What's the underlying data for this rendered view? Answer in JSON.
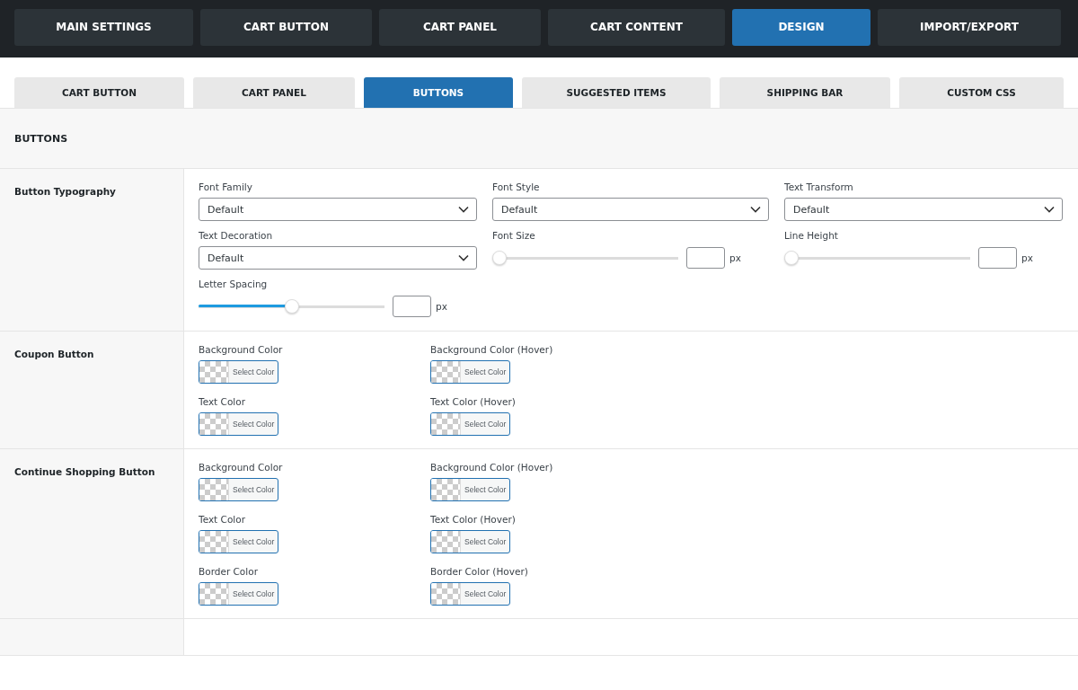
{
  "main_tabs": [
    {
      "label": "MAIN SETTINGS",
      "selected": false
    },
    {
      "label": "CART BUTTON",
      "selected": false
    },
    {
      "label": "CART PANEL",
      "selected": false
    },
    {
      "label": "CART CONTENT",
      "selected": false
    },
    {
      "label": "DESIGN",
      "selected": true
    },
    {
      "label": "IMPORT/EXPORT",
      "selected": false
    }
  ],
  "sub_tabs": [
    {
      "label": "CART BUTTON",
      "selected": false
    },
    {
      "label": "CART PANEL",
      "selected": false
    },
    {
      "label": "BUTTONS",
      "selected": true
    },
    {
      "label": "SUGGESTED ITEMS",
      "selected": false
    },
    {
      "label": "SHIPPING BAR",
      "selected": false
    },
    {
      "label": "CUSTOM CSS",
      "selected": false
    }
  ],
  "section_title": "BUTTONS",
  "rows": [
    {
      "label": "Button Typography",
      "kind": "typography",
      "fields": [
        {
          "kind": "select",
          "label": "Font Family",
          "value": "Default"
        },
        {
          "kind": "select",
          "label": "Font Style",
          "value": "Default"
        },
        {
          "kind": "select",
          "label": "Text Transform",
          "value": "Default"
        },
        {
          "kind": "select",
          "label": "Text Decoration",
          "value": "Default"
        },
        {
          "kind": "slider",
          "label": "Font Size",
          "level": 0,
          "unit": "px"
        },
        {
          "kind": "slider",
          "label": "Line Height",
          "level": 0,
          "unit": "px"
        },
        {
          "kind": "slider",
          "label": "Letter Spacing",
          "level": 0.5,
          "unit": "px"
        }
      ]
    },
    {
      "label": "Coupon Button",
      "kind": "colors",
      "fields": [
        {
          "label": "Background Color",
          "button": "Select Color"
        },
        {
          "label": "Background Color (Hover)",
          "button": "Select Color"
        },
        {
          "label": "Text Color",
          "button": "Select Color"
        },
        {
          "label": "Text Color (Hover)",
          "button": "Select Color"
        }
      ]
    },
    {
      "label": "Continue Shopping Button",
      "kind": "colors",
      "fields": [
        {
          "label": "Background Color",
          "button": "Select Color"
        },
        {
          "label": "Background Color (Hover)",
          "button": "Select Color"
        },
        {
          "label": "Text Color",
          "button": "Select Color"
        },
        {
          "label": "Text Color (Hover)",
          "button": "Select Color"
        },
        {
          "label": "Border Color",
          "button": "Select Color"
        },
        {
          "label": "Border Color (Hover)",
          "button": "Select Color"
        }
      ]
    }
  ]
}
